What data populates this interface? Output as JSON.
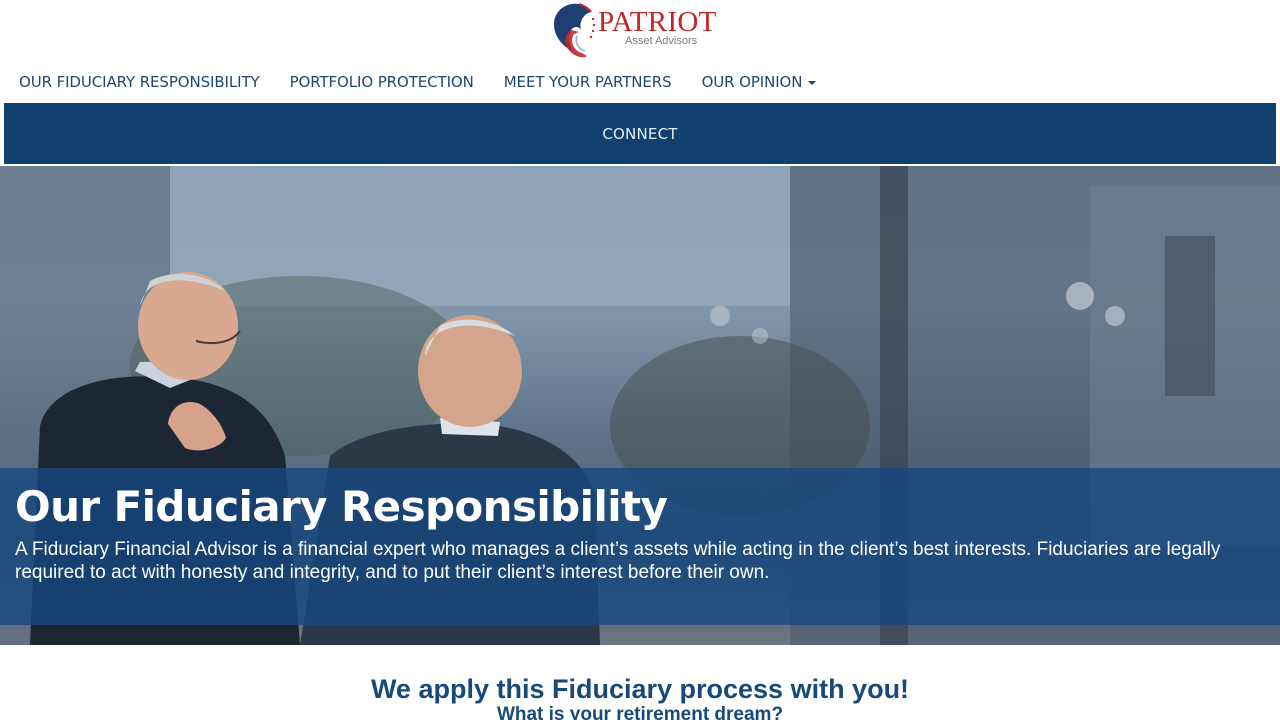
{
  "brand": {
    "name": "PATRIOT",
    "tagline": "Asset Advisors"
  },
  "nav": {
    "items": [
      {
        "label": "OUR FIDUCIARY RESPONSIBILITY"
      },
      {
        "label": "PORTFOLIO PROTECTION"
      },
      {
        "label": "MEET YOUR PARTNERS"
      },
      {
        "label": "OUR OPINION",
        "has_dropdown": true
      }
    ],
    "connect_label": "CONNECT"
  },
  "hero": {
    "title": "Our Fiduciary Responsibility",
    "text": "A Fiduciary Financial Advisor is a financial expert who manages a client’s assets while acting in the client’s best interests. Fiduciaries are legally required to act with honesty and integrity, and to put their client’s interest before their own."
  },
  "section": {
    "title": "We apply this Fiduciary process with you!",
    "subtitle": "What is your retirement dream?"
  },
  "colors": {
    "brand_red": "#c0272d",
    "nav_text": "#1f4772",
    "connect_bar": "#0f406e",
    "hero_overlay": "#144880"
  },
  "icons": {
    "logo_mark": "eagle-flag-icon",
    "dropdown": "caret-down-icon"
  }
}
